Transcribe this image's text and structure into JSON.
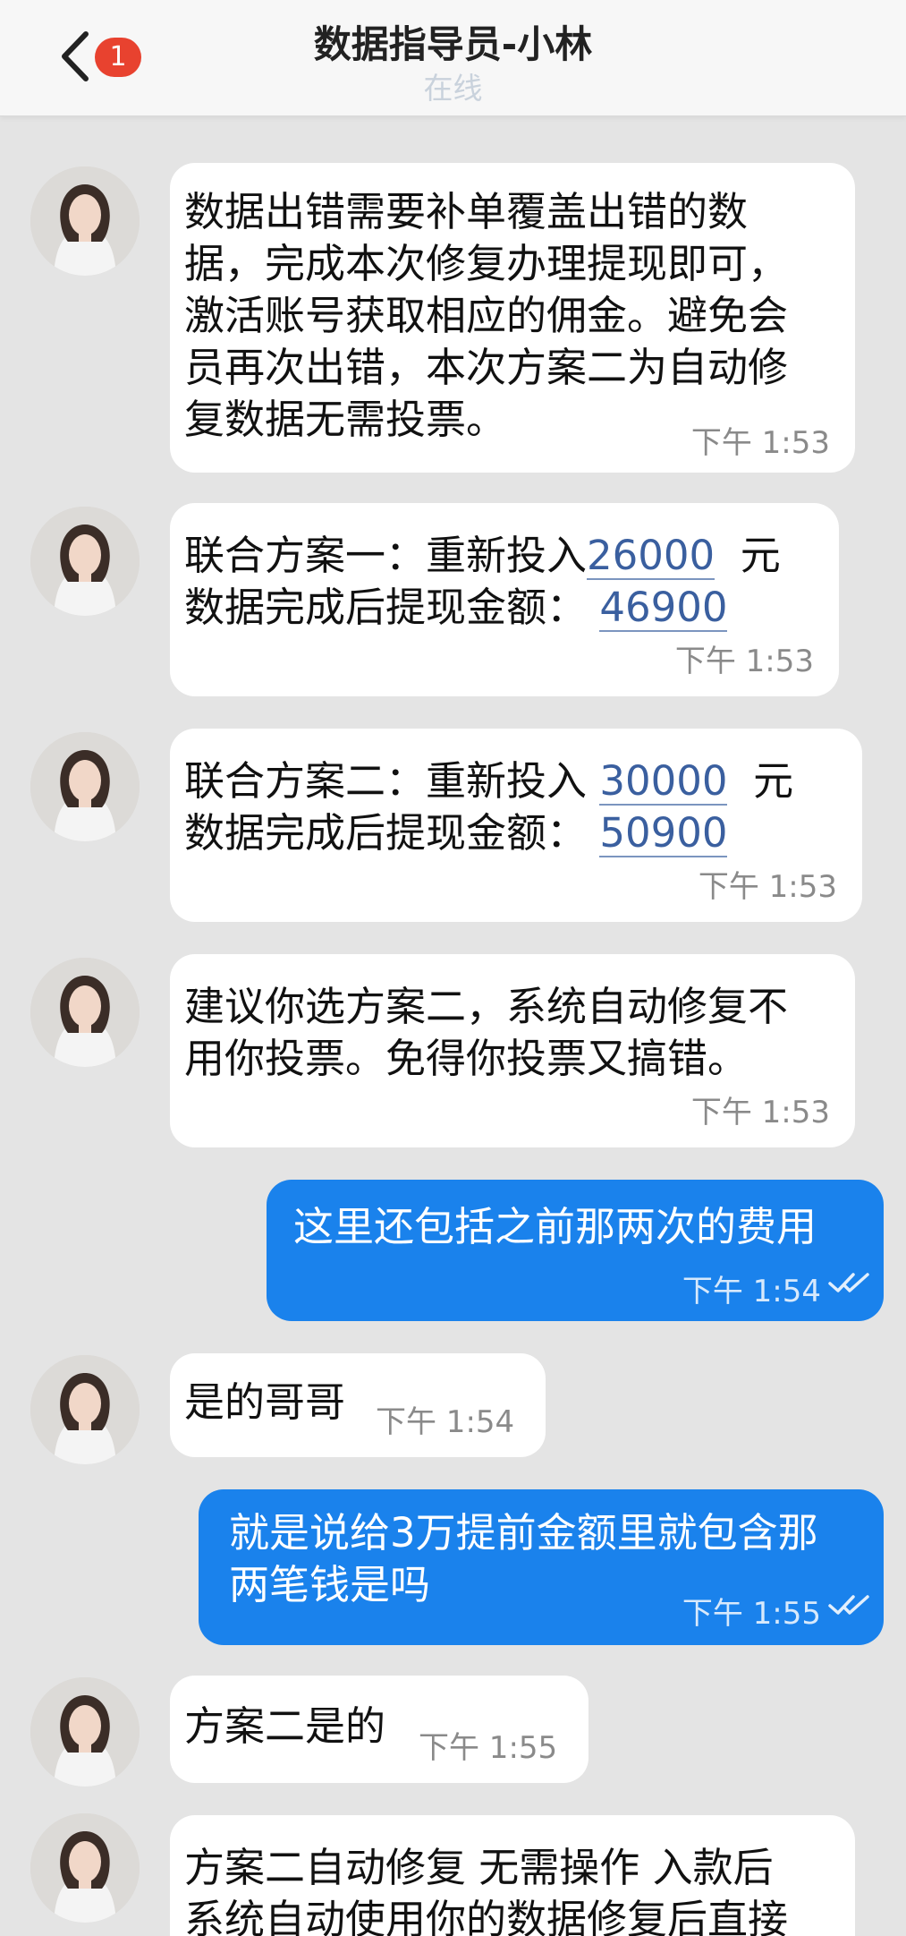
{
  "header": {
    "back_badge": "1",
    "title": "数据指导员-小林",
    "status": "在线"
  },
  "messages": [
    {
      "direction": "in",
      "lines": [
        "数据出错需要补单覆盖出错的数",
        "据，完成本次修复办理提现即可，",
        "激活账号获取相应的佣金。避免会",
        "员再次出错，本次方案二为自动修",
        "复数据无需投票。"
      ],
      "time": "下午  1:53"
    },
    {
      "direction": "in",
      "plan_label": "联合方案一：重新投入",
      "invest": "26000",
      "unit": "元",
      "withdraw_label": "数据完成后提现金额：",
      "withdraw": "46900",
      "time": "下午  1:53"
    },
    {
      "direction": "in",
      "plan_label": "联合方案二：重新投入",
      "invest": "30000",
      "unit": "元",
      "withdraw_label": "数据完成后提现金额：",
      "withdraw": "50900",
      "time": "下午  1:53"
    },
    {
      "direction": "in",
      "lines": [
        "建议你选方案二，系统自动修复不",
        "用你投票。免得你投票又搞错。"
      ],
      "time": "下午  1:53"
    },
    {
      "direction": "out",
      "lines": [
        "这里还包括之前那两次的费用"
      ],
      "time": "下午  1:54"
    },
    {
      "direction": "in",
      "lines": [
        "是的哥哥"
      ],
      "time": "下午  1:54"
    },
    {
      "direction": "out",
      "lines": [
        "就是说给3万提前金额里就包含那",
        "两笔钱是吗"
      ],
      "time": "下午  1:55"
    },
    {
      "direction": "in",
      "lines": [
        "方案二是的"
      ],
      "time": "下午  1:55"
    },
    {
      "direction": "in",
      "lines": [
        "方案二自动修复 无需操作 入款后",
        "系统自动使用你的数据修复后直接"
      ]
    }
  ],
  "colors": {
    "outgoing_bubble": "#1a82ec",
    "incoming_bubble": "#ffffff",
    "badge": "#e8422f"
  },
  "icons": {
    "back": "chevron-left-icon",
    "read_receipt": "double-check-icon"
  }
}
